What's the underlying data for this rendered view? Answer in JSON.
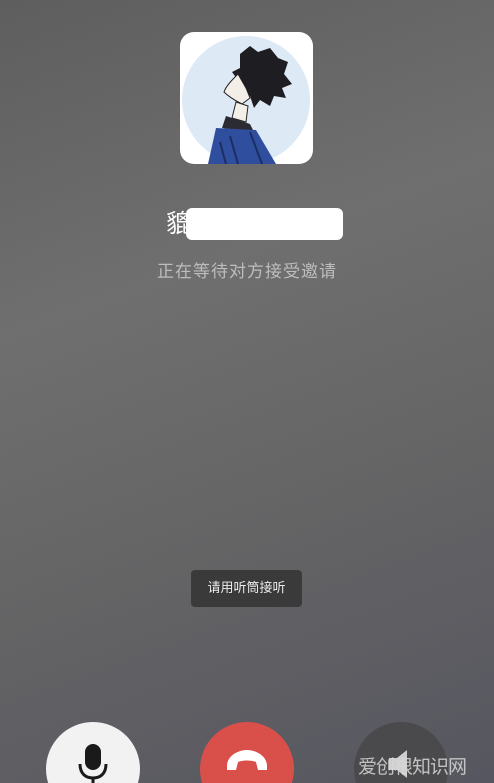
{
  "caller": {
    "name_visible_char": "貔",
    "status_text": "正在等待对方接受邀请"
  },
  "toast": {
    "text": "请用听筒接听"
  },
  "controls": {
    "mute_icon": "microphone-icon",
    "hangup_icon": "phone-hangup-icon",
    "speaker_icon": "speaker-icon"
  },
  "watermark": {
    "text": "爱创根知识网"
  },
  "colors": {
    "hangup": "#d9504b",
    "mute_bg": "#f2f2f2",
    "speaker_bg": "#4a4a4c",
    "avatar_bg": "#dde9f5"
  }
}
